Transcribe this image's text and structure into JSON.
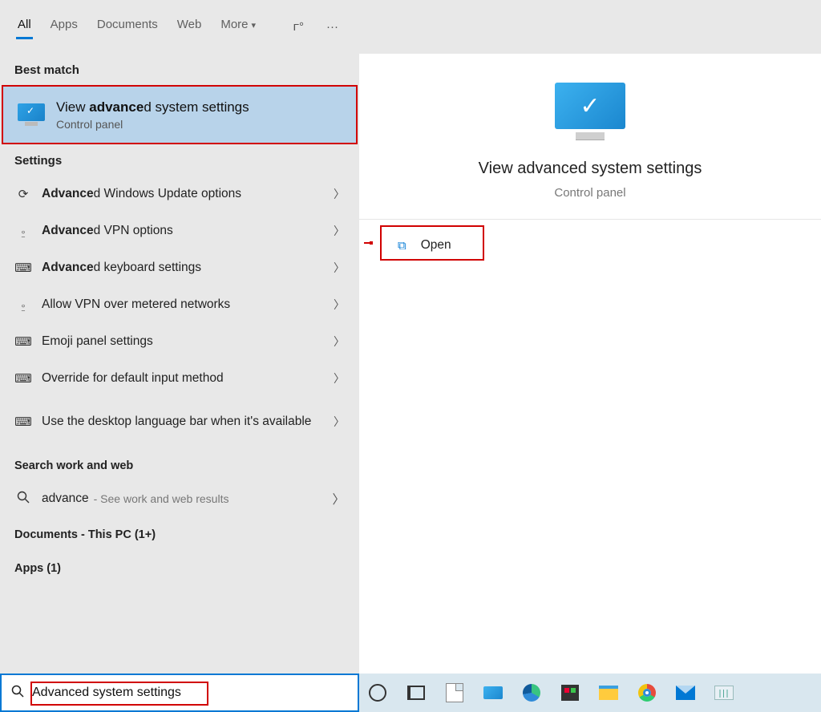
{
  "tabs": {
    "all": "All",
    "apps": "Apps",
    "documents": "Documents",
    "web": "Web",
    "more": "More"
  },
  "best_match_label": "Best match",
  "best_match": {
    "title_pre": "View ",
    "title_bold": "advance",
    "title_post": "d system settings",
    "sub": "Control panel"
  },
  "settings_label": "Settings",
  "settings": [
    {
      "icon": "refresh",
      "bold": "Advance",
      "rest": "d Windows Update options"
    },
    {
      "icon": "vpn",
      "bold": "Advance",
      "rest": "d VPN options"
    },
    {
      "icon": "keyboard",
      "bold": "Advance",
      "rest": "d keyboard settings"
    },
    {
      "icon": "vpn",
      "bold": "",
      "rest": "Allow VPN over metered networks"
    },
    {
      "icon": "keyboard",
      "bold": "",
      "rest": "Emoji panel settings"
    },
    {
      "icon": "keyboard",
      "bold": "",
      "rest": "Override for default input method"
    },
    {
      "icon": "keyboard",
      "bold": "",
      "rest": "Use the desktop language bar when it's available"
    }
  ],
  "web_label": "Search work and web",
  "web": {
    "term": "advance",
    "hint": "- See work and web results"
  },
  "docs_label": "Documents - This PC (1+)",
  "apps_label": "Apps (1)",
  "preview": {
    "title": "View advanced system settings",
    "sub": "Control panel",
    "open": "Open"
  },
  "search": {
    "value": "Advanced system settings"
  }
}
